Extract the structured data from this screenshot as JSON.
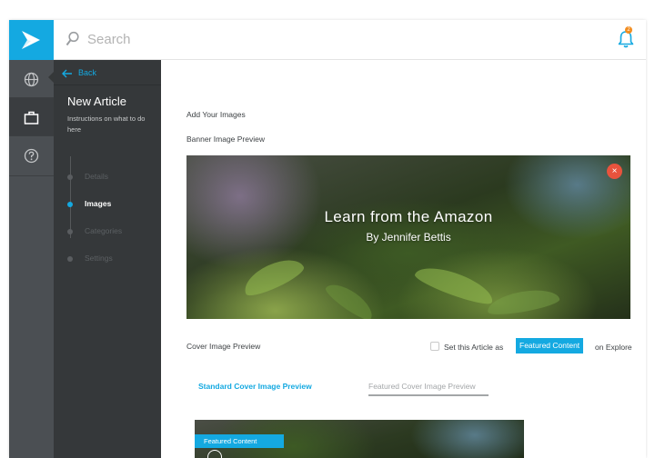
{
  "search": {
    "placeholder": "Search"
  },
  "notifications": {
    "count": "2"
  },
  "nav": {
    "back_label": "Back",
    "title": "New Article",
    "description": "Instructions on what to do here",
    "steps": [
      {
        "label": "Details",
        "active": false
      },
      {
        "label": "Images",
        "active": true
      },
      {
        "label": "Categories",
        "active": false
      },
      {
        "label": "Settings",
        "active": false
      }
    ]
  },
  "content": {
    "heading": "Add Your Images",
    "banner_label": "Banner Image Preview",
    "banner_title": "Learn from the Amazon",
    "banner_subtitle": "By Jennifer Bettis",
    "remove_symbol": "×",
    "cover_label": "Cover Image Preview",
    "featured_checkbox_label": "Set this Article as",
    "featured_tag": "Featured Content",
    "featured_suffix": "on Explore",
    "tabs": [
      {
        "label": "Standard Cover Image Preview",
        "active": true
      },
      {
        "label": "Featured Cover Image Preview",
        "active": false
      }
    ],
    "cover_badge": "Featured Content"
  },
  "colors": {
    "accent": "#14a9e1",
    "rail": "#4b4f53",
    "panel": "#35383a",
    "remove": "#e8533d",
    "badge": "#f28c1e"
  }
}
